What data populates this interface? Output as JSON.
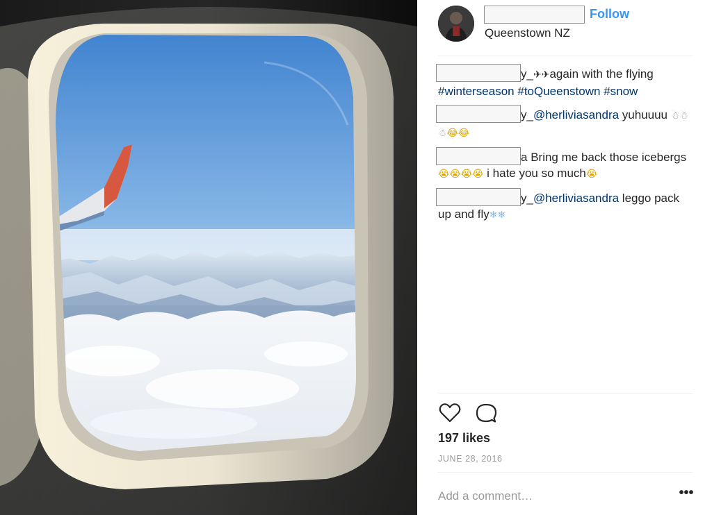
{
  "post": {
    "header": {
      "follow_label": "Follow",
      "location": "Queenstown NZ"
    },
    "comments": [
      {
        "author_tail": "y_",
        "parts": [
          {
            "type": "emoji",
            "text": "✈✈",
            "tone": "dark"
          },
          {
            "type": "text",
            "text": "again with the flying "
          },
          {
            "type": "hashtag",
            "text": "#winterseason"
          },
          {
            "type": "text",
            "text": " "
          },
          {
            "type": "hashtag",
            "text": "#toQueenstown"
          },
          {
            "type": "text",
            "text": " "
          },
          {
            "type": "hashtag",
            "text": "#snow"
          }
        ]
      },
      {
        "author_tail": "y_",
        "parts": [
          {
            "type": "mention",
            "text": "@herliviasandra"
          },
          {
            "type": "text",
            "text": " yuhuuuu "
          },
          {
            "type": "emoji",
            "text": "☃☃☃",
            "tone": "gray"
          },
          {
            "type": "emoji",
            "text": "😂😂",
            "tone": "yellow"
          }
        ]
      },
      {
        "author_tail": "a",
        "parts": [
          {
            "type": "text",
            "text": " Bring me back those icebergs"
          },
          {
            "type": "emoji",
            "text": "😭😭😭😭",
            "tone": "yellow"
          },
          {
            "type": "text",
            "text": " i hate you so much"
          },
          {
            "type": "emoji",
            "text": "😭",
            "tone": "yellow"
          }
        ]
      },
      {
        "author_tail": "y_",
        "parts": [
          {
            "type": "mention",
            "text": "@herliviasandra"
          },
          {
            "type": "text",
            "text": " leggo pack up and fly"
          },
          {
            "type": "emoji",
            "text": "❄❄",
            "tone": "blue"
          }
        ]
      }
    ],
    "actions": {
      "like_icon": "heart-outline-icon",
      "comment_icon": "comment-bubble-icon"
    },
    "likes": "197 likes",
    "date": "JUNE 28, 2016",
    "add_comment_placeholder": "Add a comment…",
    "more_label": "•••"
  },
  "colors": {
    "follow": "#3897f0",
    "link": "#003569",
    "text": "#262626",
    "muted": "#999999",
    "divider": "#efefef"
  }
}
